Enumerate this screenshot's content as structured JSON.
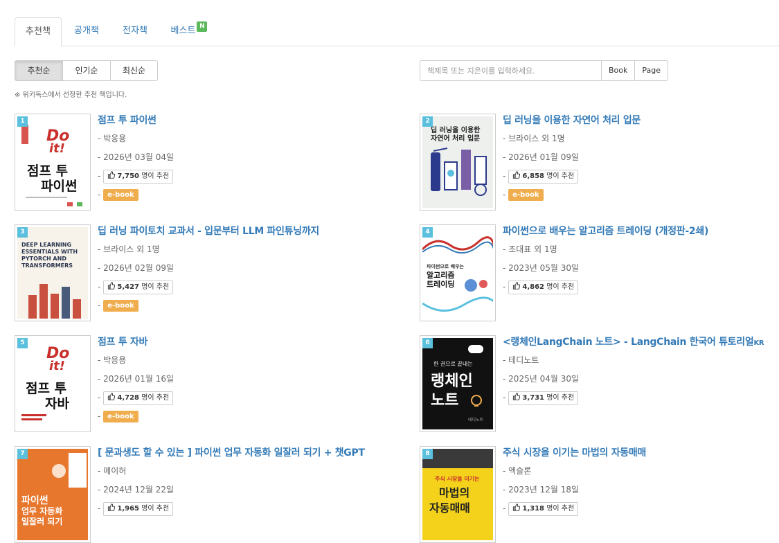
{
  "tabs": [
    {
      "label": "추천책"
    },
    {
      "label": "공개책"
    },
    {
      "label": "전자책"
    },
    {
      "label": "베스트",
      "badge": "N"
    }
  ],
  "sort": [
    {
      "label": "추천순"
    },
    {
      "label": "인기순"
    },
    {
      "label": "최신순"
    }
  ],
  "search": {
    "placeholder": "책제목 또는 지은이를 입력하세요.",
    "book_button": "Book",
    "page_button": "Page"
  },
  "note": "※ 위키독스에서 선정한 추천 책입니다.",
  "dash": "-",
  "rec_suffix": "명이 추천",
  "books": [
    {
      "rank": "1",
      "title": "점프 투 파이썬",
      "author": "박응용",
      "date": "2026년 03월 04일",
      "rec": "7,750",
      "ebook": "e-book",
      "cover": {
        "line1": "Do",
        "line2": "it!",
        "line3": "점프 투",
        "line4": "파이썬"
      }
    },
    {
      "rank": "2",
      "title": "딥 러닝을 이용한 자연어 처리 입문",
      "author": "브라이스 외 1명",
      "date": "2026년 01월 09일",
      "rec": "6,858",
      "ebook": "e-book",
      "cover": {
        "line1": "딥 러닝을 이용한",
        "line2": "자연어 처리 입문"
      }
    },
    {
      "rank": "3",
      "title": "딥 러닝 파이토치 교과서 - 입문부터 LLM 파인튜닝까지",
      "author": "브라이스 외 1명",
      "date": "2026년 02월 09일",
      "rec": "5,427",
      "ebook": "e-book",
      "cover": {
        "line1": "DEEP LEARNING",
        "line2": "ESSENTIALS WITH",
        "line3": "PYTORCH AND",
        "line4": "TRANSFORMERS"
      }
    },
    {
      "rank": "4",
      "title": "파이썬으로 배우는 알고리즘 트레이딩 (개정판-2쇄)",
      "author": "조대표 외 1명",
      "date": "2023년 05월 30일",
      "rec": "4,862",
      "cover": {
        "line1": "파이썬으로 배우는",
        "line2": "알고리즘",
        "line3": "트레이딩"
      }
    },
    {
      "rank": "5",
      "title": "점프 투 자바",
      "author": "박응용",
      "date": "2026년 01월 16일",
      "rec": "4,728",
      "ebook": "e-book",
      "cover": {
        "line1": "Do",
        "line2": "it!",
        "line3": "점프 투",
        "line4": "자바"
      }
    },
    {
      "rank": "6",
      "title": "<랭체인LangChain 노트> - LangChain 한국어 튜토리얼",
      "title_suffix": "KR",
      "author": "테디노트",
      "date": "2025년 04월 30일",
      "rec": "3,731",
      "cover": {
        "line1": "한 권으로 끝내는",
        "line2": "랭체인",
        "line3": "노트",
        "line4": "테디노트"
      }
    },
    {
      "rank": "7",
      "title": "[ 문과생도 할 수 있는 ] 파이썬 업무 자동화 일잘러 되기 + 챗GPT",
      "author": "메이허",
      "date": "2024년 12월 22일",
      "rec": "1,965",
      "cover": {
        "line1": "파이썬",
        "line2": "업무 자동화",
        "line3": "일잘러 되기"
      }
    },
    {
      "rank": "8",
      "title": "주식 시장을 이기는 마법의 자동매매",
      "author": "엑슬론",
      "date": "2023년 12월 18일",
      "rec": "1,318",
      "cover": {
        "line1": "주식 시장을 이기는",
        "line2": "마법의",
        "line3": "자동매매"
      }
    }
  ],
  "colors": {
    "link": "#337ab7",
    "rank_badge": "#5bc0de",
    "ebook_badge": "#f0ad4e",
    "new_badge": "#5cb85c"
  },
  "icons": {
    "recommend": "thumbs-up-icon"
  }
}
